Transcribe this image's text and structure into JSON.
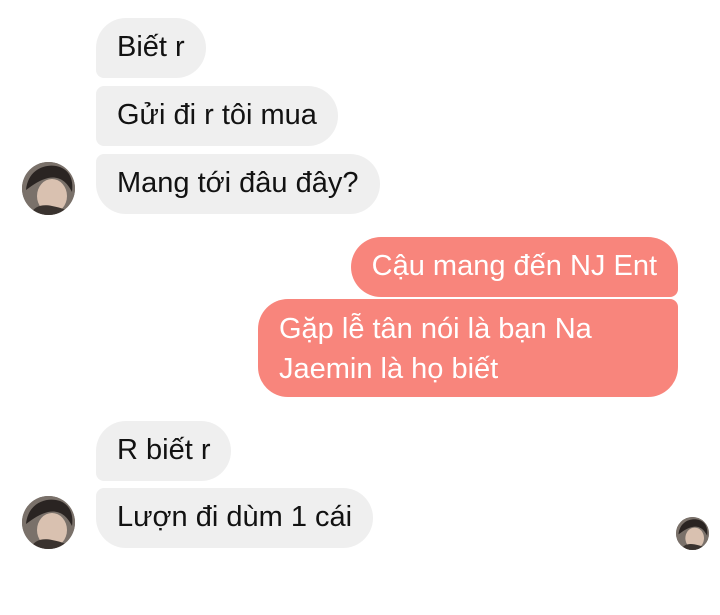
{
  "colors": {
    "incoming_bubble": "#efefef",
    "incoming_text": "#121212",
    "outgoing_bubble": "#f8857c",
    "outgoing_text": "#ffffff"
  },
  "messages": [
    {
      "sender": "other",
      "text": "Biết r"
    },
    {
      "sender": "other",
      "text": "Gửi đi r tôi mua"
    },
    {
      "sender": "other",
      "text": "Mang tới đâu đây?"
    },
    {
      "sender": "me",
      "text": "Cậu mang đến NJ Ent"
    },
    {
      "sender": "me",
      "text": "Gặp lễ tân nói là bạn Na Jaemin là họ biết"
    },
    {
      "sender": "other",
      "text": "R biết r"
    },
    {
      "sender": "other",
      "text": "Lượn đi dùm 1 cái"
    }
  ],
  "icons": {
    "contact_avatar": "avatar-photo",
    "read_receipt": "seen-avatar-photo"
  }
}
